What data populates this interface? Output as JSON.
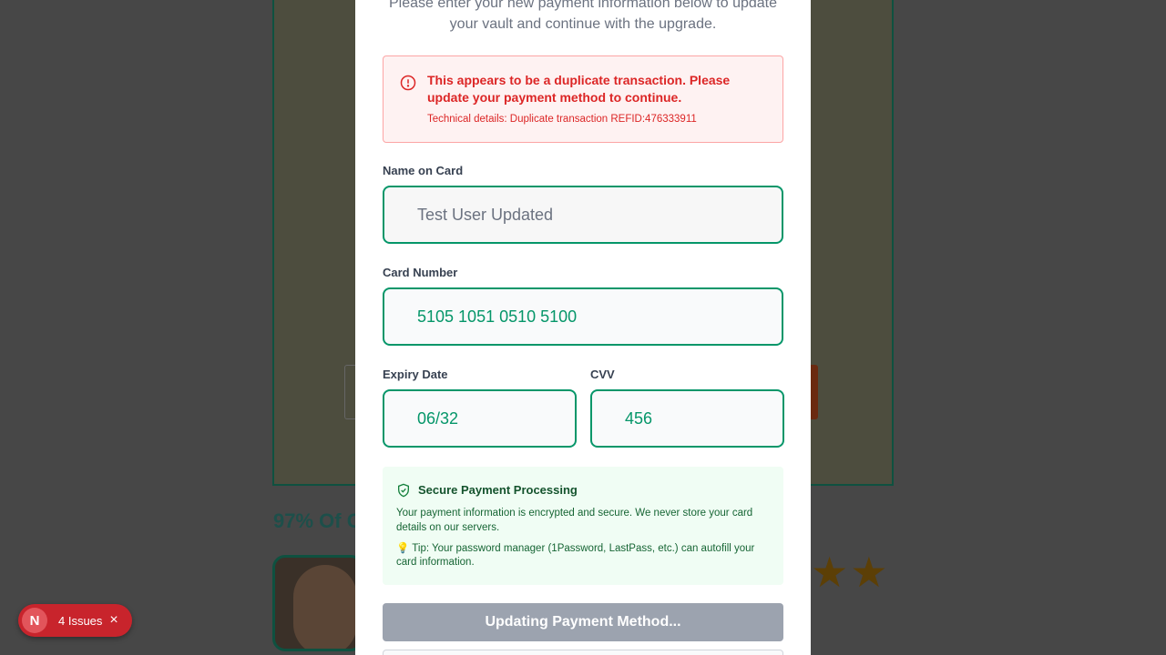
{
  "background": {
    "heading": "97% Of C",
    "stars": "★★"
  },
  "issues_badge": {
    "logo": "N",
    "count_label": "4 Issues",
    "close": "×"
  },
  "modal": {
    "intro": "Please enter your new payment information below to update your vault and continue with the upgrade.",
    "alert": {
      "icon": "alert-circle-icon",
      "title": "This appears to be a duplicate transaction. Please update your payment method to continue.",
      "detail": "Technical details: Duplicate transaction REFID:476333911"
    },
    "name_on_card": {
      "label": "Name on Card",
      "value": "Test User Updated"
    },
    "card_number": {
      "label": "Card Number",
      "value": "5105 1051 0510 5100"
    },
    "expiry": {
      "label": "Expiry Date",
      "value": "06/32"
    },
    "cvv": {
      "label": "CVV",
      "value": "456"
    },
    "secure": {
      "icon": "shield-check-icon",
      "title": "Secure Payment Processing",
      "text": "Your payment information is encrypted and secure. We never store your card details on our servers.",
      "tip": "💡 Tip: Your password manager (1Password, LastPass, etc.) can autofill your card information."
    },
    "submit_label": "Updating Payment Method...",
    "colors": {
      "accent": "#059669",
      "error": "#dc2626",
      "success_bg": "#f0fdf4",
      "disabled": "#9ca3af"
    }
  }
}
